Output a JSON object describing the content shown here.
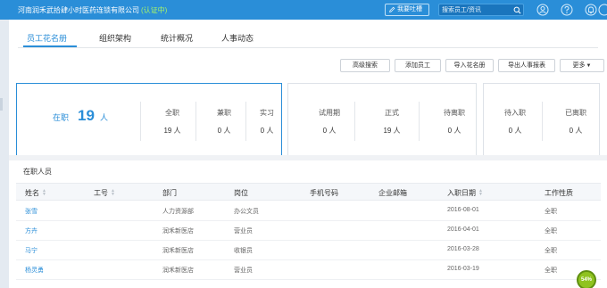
{
  "header": {
    "company": "河南润禾武拾肆小时医药连锁有限公司",
    "verified": "(认证中)",
    "feedback_label": "我要吐槽",
    "search_placeholder": "搜索员工/资讯",
    "icons": [
      "user-circle-icon",
      "help-icon",
      "bell-icon",
      "more-icon"
    ]
  },
  "tabs": [
    {
      "label": "员工花名册",
      "active": true
    },
    {
      "label": "组织架构",
      "active": false
    },
    {
      "label": "统计概况",
      "active": false
    },
    {
      "label": "人事动态",
      "active": false
    }
  ],
  "toolbar": {
    "advanced_search": "高级搜索",
    "add_employee": "添加员工",
    "import_roster": "导入花名册",
    "export_report": "导出人事报表",
    "more": "更多"
  },
  "stats": {
    "on_job_label": "在职",
    "on_job_count": "19",
    "on_job_unit": "人",
    "full_time": {
      "label": "全职",
      "value": "19 人"
    },
    "part_time": {
      "label": "兼职",
      "value": "0 人"
    },
    "intern": {
      "label": "实习",
      "value": "0 人"
    },
    "probation": {
      "label": "试用期",
      "value": "0 人"
    },
    "regular": {
      "label": "正式",
      "value": "19 人"
    },
    "pending_leave": {
      "label": "待离职",
      "value": "0 人"
    },
    "pending_join": {
      "label": "待入职",
      "value": "0 人"
    },
    "left": {
      "label": "已离职",
      "value": "0 人"
    }
  },
  "list": {
    "title": "在职人员",
    "columns": [
      "姓名",
      "工号",
      "部门",
      "岗位",
      "手机号码",
      "企业邮箱",
      "入职日期",
      "工作性质"
    ],
    "rows": [
      {
        "name": "张雪",
        "id": "",
        "dept": "人力资源部",
        "post": "办公文员",
        "phone": "",
        "email": "",
        "date": "2016-08-01",
        "type": "全职"
      },
      {
        "name": "方卉",
        "id": "",
        "dept": "润禾新医店",
        "post": "营业员",
        "phone": "",
        "email": "",
        "date": "2016-04-01",
        "type": "全职"
      },
      {
        "name": "马宁",
        "id": "",
        "dept": "润禾新医店",
        "post": "收银员",
        "phone": "",
        "email": "",
        "date": "2016-03-28",
        "type": "全职"
      },
      {
        "name": "杨灵勇",
        "id": "",
        "dept": "润禾新医店",
        "post": "营业员",
        "phone": "",
        "email": "",
        "date": "2016-03-19",
        "type": "全职"
      }
    ]
  },
  "progress_badge": "54%",
  "colors": {
    "primary": "#2a8ed8",
    "verified": "#a7f36a"
  }
}
